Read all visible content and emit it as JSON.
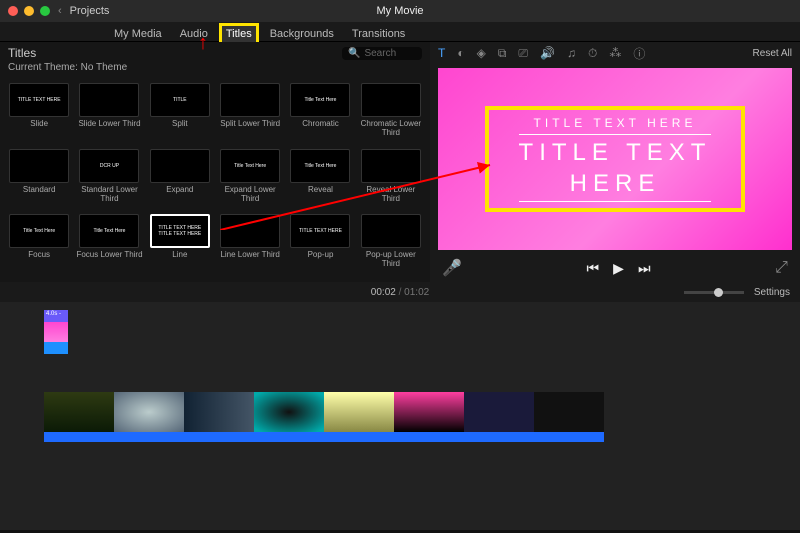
{
  "window": {
    "back": "‹",
    "projects": "Projects",
    "title": "My Movie"
  },
  "tabs": [
    {
      "label": "My Media"
    },
    {
      "label": "Audio"
    },
    {
      "label": "Titles",
      "highlight": true
    },
    {
      "label": "Backgrounds"
    },
    {
      "label": "Transitions"
    }
  ],
  "browser": {
    "heading": "Titles",
    "search": "Search",
    "theme": "Current Theme: No Theme",
    "items": [
      {
        "thumb": "TITLE TEXT HERE",
        "label": "Slide"
      },
      {
        "thumb": "",
        "label": "Slide Lower Third"
      },
      {
        "thumb": "TITLE",
        "label": "Split"
      },
      {
        "thumb": "",
        "label": "Split Lower Third"
      },
      {
        "thumb": "Title Text Here",
        "label": "Chromatic"
      },
      {
        "thumb": "",
        "label": "Chromatic Lower Third"
      },
      {
        "thumb": "",
        "label": "Standard"
      },
      {
        "thumb": "DCR UP",
        "label": "Standard Lower Third"
      },
      {
        "thumb": "",
        "label": "Expand"
      },
      {
        "thumb": "Title Text Here",
        "label": "Expand Lower Third"
      },
      {
        "thumb": "Title Text Here",
        "label": "Reveal"
      },
      {
        "thumb": "",
        "label": "Reveal Lower Third"
      },
      {
        "thumb": "Title Text Here",
        "label": "Focus"
      },
      {
        "thumb": "Title Text Here",
        "label": "Focus Lower Third"
      },
      {
        "thumb": "TITLE TEXT HERE\nTITLE TEXT HERE",
        "label": "Line",
        "selected": true
      },
      {
        "thumb": "",
        "label": "Line Lower Third"
      },
      {
        "thumb": "TITLE TEXT HERE",
        "label": "Pop-up"
      },
      {
        "thumb": "",
        "label": "Pop-up Lower Third"
      }
    ]
  },
  "toolbar": {
    "reset": "Reset All"
  },
  "preview": {
    "sub": "TITLE TEXT HERE",
    "main": "TITLE TEXT\nHERE"
  },
  "playback": {
    "current": "00:02",
    "total": "01:02",
    "settings": "Settings"
  },
  "timeline": {
    "titleClip": "4.0s -"
  }
}
